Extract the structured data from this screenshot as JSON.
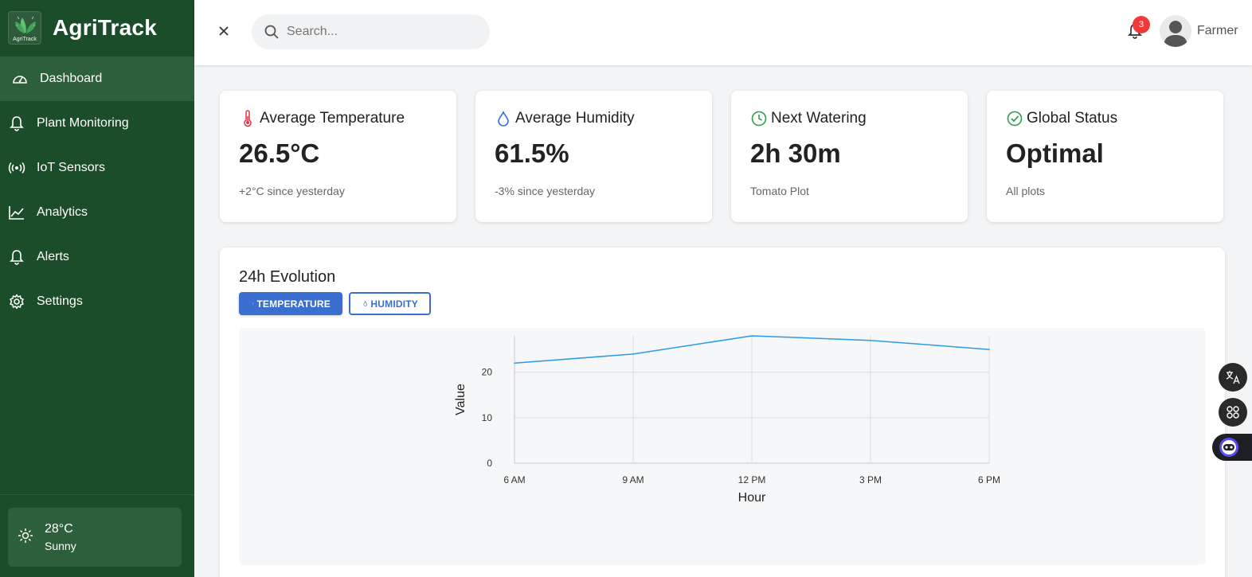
{
  "app": {
    "name": "AgriTrack",
    "logo_text": "AgriTrack"
  },
  "sidebar": {
    "items": [
      {
        "label": "Dashboard",
        "icon": "gauge-icon"
      },
      {
        "label": "Plant Monitoring",
        "icon": "bell-icon"
      },
      {
        "label": "IoT Sensors",
        "icon": "signal-icon"
      },
      {
        "label": "Analytics",
        "icon": "chart-line-icon"
      },
      {
        "label": "Alerts",
        "icon": "bell-icon"
      },
      {
        "label": "Settings",
        "icon": "gear-icon"
      }
    ],
    "weather": {
      "temp": "28°C",
      "desc": "Sunny",
      "icon": "sun-icon"
    }
  },
  "header": {
    "search_placeholder": "Search...",
    "notifications": "3",
    "user": "Farmer"
  },
  "cards": [
    {
      "title": "Average Temperature",
      "value": "26.5°C",
      "sub": "+2°C since yesterday",
      "icon": "thermometer-icon",
      "color": "#e0354a"
    },
    {
      "title": "Average Humidity",
      "value": "61.5%",
      "sub": "-3% since yesterday",
      "icon": "droplet-icon",
      "color": "#3a6fd0"
    },
    {
      "title": "Next Watering",
      "value": "2h 30m",
      "sub": "Tomato Plot",
      "icon": "clock-icon",
      "color": "#2e9e4f"
    },
    {
      "title": "Global Status",
      "value": "Optimal",
      "sub": "All plots",
      "icon": "check-circle-icon",
      "color": "#2e9e4f"
    }
  ],
  "panel": {
    "title": "24h Evolution",
    "toggles": [
      {
        "label": "TEMPERATURE",
        "active": true
      },
      {
        "label": "HUMIDITY",
        "active": false
      }
    ]
  },
  "chart_data": {
    "type": "line",
    "categories": [
      "6 AM",
      "9 AM",
      "12 PM",
      "3 PM",
      "6 PM"
    ],
    "series": [
      {
        "values": [
          22,
          24,
          28,
          27,
          25
        ],
        "color": "#2b9be5"
      }
    ],
    "xlabel": "Hour",
    "ylabel": "Value",
    "yticks": [
      0,
      10,
      20
    ],
    "ylim": [
      0,
      28
    ],
    "grid": true
  },
  "colors": {
    "sidebar": "#1b4d2b",
    "sidebar_active": "#2e5f3c",
    "accent": "#3a6fd0",
    "badge": "#f03a3a"
  }
}
